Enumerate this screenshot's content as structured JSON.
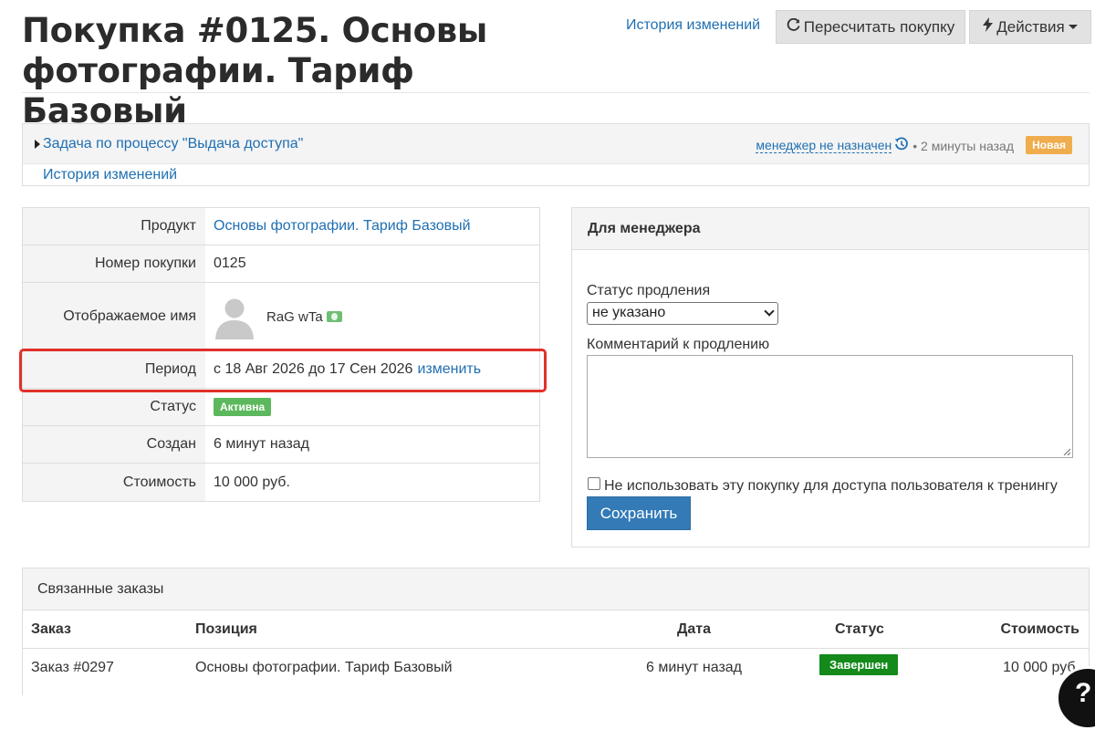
{
  "header": {
    "title": "Покупка #0125. Основы фотографии. Тариф Базовый",
    "history_link": "История изменений",
    "recalc_button": "Пересчитать покупку",
    "actions_button": "Действия"
  },
  "task": {
    "title": "Задача по процессу \"Выдача доступа\"",
    "manager": "менеджер не назначен",
    "time": "• 2 минуты назад",
    "badge": "Новая",
    "history_link": "История изменений"
  },
  "info": {
    "product_label": "Продукт",
    "product_value": "Основы фотографии. Тариф Базовый",
    "number_label": "Номер покупки",
    "number_value": "0125",
    "name_label": "Отображаемое имя",
    "name_value": "RaG wTa",
    "period_label": "Период",
    "period_value": "с 18 Авг 2026 до 17 Сен 2026",
    "period_change": "изменить",
    "status_label": "Статус",
    "status_value": "Активна",
    "created_label": "Создан",
    "created_value": "6 минут назад",
    "cost_label": "Стоимость",
    "cost_value": "10 000 руб."
  },
  "manager_panel": {
    "title": "Для менеджера",
    "renewal_status_label": "Статус продления",
    "renewal_status_value": "не указано",
    "comment_label": "Комментарий к продлению",
    "comment_value": "",
    "exclude_checkbox_label": "Не использовать эту покупку для доступа пользователя к тренингу",
    "exclude_checked": false,
    "save_button": "Сохранить"
  },
  "orders": {
    "title": "Связанные заказы",
    "columns": [
      "Заказ",
      "Позиция",
      "Дата",
      "Статус",
      "Стоимость"
    ],
    "rows": [
      {
        "order": "Заказ #0297",
        "position": "Основы фотографии. Тариф Базовый",
        "date": "6 минут назад",
        "status": "Завершен",
        "cost": "10 000 руб."
      }
    ]
  },
  "help": {
    "label": "?"
  },
  "colors": {
    "link": "#1f6fb2",
    "badge_new": "#f0ad4e",
    "badge_active": "#5cb85c",
    "badge_done": "#138a1a",
    "primary_button": "#337ab7",
    "highlight": "#e0312a"
  }
}
